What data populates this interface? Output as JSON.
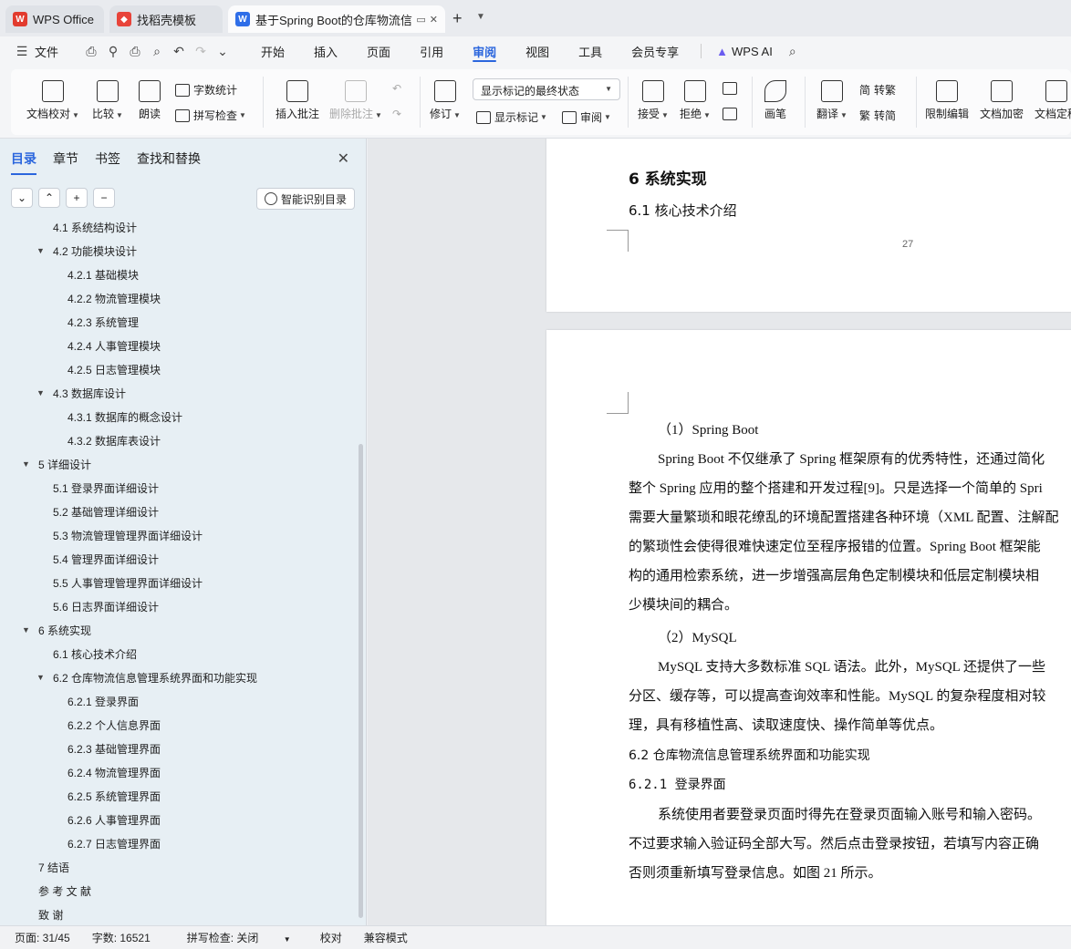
{
  "tabs": [
    {
      "label": "WPS Office"
    },
    {
      "label": "找稻壳模板"
    },
    {
      "label": "基于Spring Boot的仓库物流信息管理系统"
    }
  ],
  "menubar": {
    "file": "文件",
    "items": [
      "开始",
      "插入",
      "页面",
      "引用",
      "审阅",
      "视图",
      "工具",
      "会员专享"
    ],
    "active": "审阅",
    "ai": "WPS AI"
  },
  "ribbon": {
    "doc_check": "文档校对",
    "compare": "比较",
    "read_aloud": "朗读",
    "word_count": "字数统计",
    "spell_check": "拼写检查",
    "insert_comment": "插入批注",
    "delete_comment": "删除批注",
    "track_changes": "修订",
    "markup_state": "显示标记的最终状态",
    "show_markup": "显示标记",
    "review": "审阅",
    "accept": "接受",
    "reject": "拒绝",
    "pen": "画笔",
    "translate": "翻译",
    "to_traditional": "转繁",
    "to_simplified": "转简",
    "restrict_edit": "限制编辑",
    "encrypt": "文档加密",
    "finalize": "文档定稿"
  },
  "nav": {
    "tabs": [
      "目录",
      "章节",
      "书签",
      "查找和替换"
    ],
    "smart_toc": "智能识别目录",
    "items": [
      {
        "level": 1,
        "arrow": "",
        "text": "4.1   系统结构设计"
      },
      {
        "level": 1,
        "arrow": "▼",
        "text": "4.2   功能模块设计"
      },
      {
        "level": 2,
        "arrow": "",
        "text": "4.2.1  基础模块"
      },
      {
        "level": 2,
        "arrow": "",
        "text": "4.2.2  物流管理模块"
      },
      {
        "level": 2,
        "arrow": "",
        "text": "4.2.3  系统管理"
      },
      {
        "level": 2,
        "arrow": "",
        "text": "4.2.4  人事管理模块"
      },
      {
        "level": 2,
        "arrow": "",
        "text": "4.2.5  日志管理模块"
      },
      {
        "level": 1,
        "arrow": "▼",
        "text": "4.3   数据库设计"
      },
      {
        "level": 2,
        "arrow": "",
        "text": "4.3.1  数据库的概念设计"
      },
      {
        "level": 2,
        "arrow": "",
        "text": "4.3.2  数据库表设计"
      },
      {
        "level": 0,
        "arrow": "▼",
        "text": "5   详细设计"
      },
      {
        "level": 1,
        "arrow": "",
        "text": "5.1   登录界面详细设计"
      },
      {
        "level": 1,
        "arrow": "",
        "text": "5.2   基础管理详细设计"
      },
      {
        "level": 1,
        "arrow": "",
        "text": "5.3   物流管理管理界面详细设计"
      },
      {
        "level": 1,
        "arrow": "",
        "text": "5.4   管理界面详细设计"
      },
      {
        "level": 1,
        "arrow": "",
        "text": "5.5   人事管理管理界面详细设计"
      },
      {
        "level": 1,
        "arrow": "",
        "text": "5.6   日志界面详细设计"
      },
      {
        "level": 0,
        "arrow": "▼",
        "text": "6   系统实现"
      },
      {
        "level": 1,
        "arrow": "",
        "text": "6.1   核心技术介绍"
      },
      {
        "level": 1,
        "arrow": "▼",
        "text": "6.2   仓库物流信息管理系统界面和功能实现"
      },
      {
        "level": 2,
        "arrow": "",
        "text": "6.2.1  登录界面"
      },
      {
        "level": 2,
        "arrow": "",
        "text": "6.2.2  个人信息界面"
      },
      {
        "level": 2,
        "arrow": "",
        "text": "6.2.3  基础管理界面"
      },
      {
        "level": 2,
        "arrow": "",
        "text": "6.2.4  物流管理界面"
      },
      {
        "level": 2,
        "arrow": "",
        "text": "6.2.5  系统管理界面"
      },
      {
        "level": 2,
        "arrow": "",
        "text": "6.2.6  人事管理界面"
      },
      {
        "level": 2,
        "arrow": "",
        "text": "6.2.7  日志管理界面"
      },
      {
        "level": 0,
        "arrow": "",
        "text": "7   结语"
      },
      {
        "level": 0,
        "arrow": "",
        "text": "参  考  文  献"
      },
      {
        "level": 0,
        "arrow": "",
        "text": "致        谢"
      }
    ]
  },
  "doc": {
    "h1": "6   系统实现",
    "h2_1": "6.1    核心技术介绍",
    "page_number": "27",
    "p1_title": "（1）Spring Boot",
    "p1_lines": [
      "Spring Boot 不仅继承了 Spring 框架原有的优秀特性，还通过简化",
      "整个 Spring 应用的整个搭建和开发过程[9]。只是选择一个简单的 Spri",
      "需要大量繁琐和眼花缭乱的环境配置搭建各种环境（XML 配置、注解配",
      "的繁琐性会使得很难快速定位至程序报错的位置。Spring Boot 框架能",
      "构的通用检索系统，进一步增强高层角色定制模块和低层定制模块相",
      "少模块间的耦合。"
    ],
    "p2_title": "（2）MySQL",
    "p2_lines": [
      "MySQL 支持大多数标准 SQL 语法。此外，MySQL 还提供了一些",
      "分区、缓存等，可以提高查询效率和性能。MySQL 的复杂程度相对较",
      "理，具有移植性高、读取速度快、操作简单等优点。"
    ],
    "h2_2": "6.2    仓库物流信息管理系统界面和功能实现",
    "h3": "6.2.1  登录界面",
    "p3_lines": [
      "系统使用者要登录页面时得先在登录页面输入账号和输入密码。",
      "不过要求输入验证码全部大写。然后点击登录按钮，若填写内容正确",
      "否则须重新填写登录信息。如图 21 所示。"
    ]
  },
  "status": {
    "page": "页面: 31/45",
    "words": "字数: 16521",
    "spell": "拼写检查: 关闭",
    "proof": "校对",
    "compat": "兼容模式"
  },
  "colors": {
    "accent": "#2b66dd",
    "wps_red": "#e23b2e",
    "docer_red": "#e8443a",
    "word_blue": "#2f6ee8"
  }
}
